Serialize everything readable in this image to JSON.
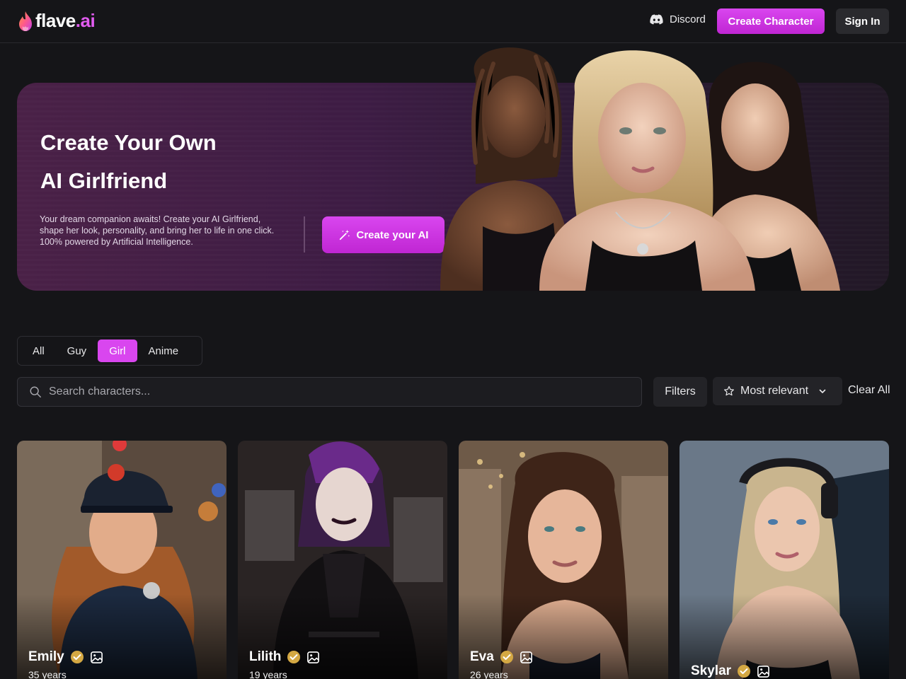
{
  "header": {
    "logo_text_main": "flave",
    "logo_text_suffix": ".ai",
    "discord_label": "Discord",
    "create_character_label": "Create Character",
    "sign_in_label": "Sign In"
  },
  "hero": {
    "title_line1": "Create Your Own",
    "title_line2": "AI Girlfriend",
    "description": "Your dream companion awaits! Create your AI Girlfriend, shape her look, personality, and bring her to life in one click. 100% powered by Artificial Intelligence.",
    "cta_label": "Create your AI"
  },
  "categories": {
    "tabs": [
      {
        "label": "All",
        "active": false
      },
      {
        "label": "Guy",
        "active": false
      },
      {
        "label": "Girl",
        "active": true
      },
      {
        "label": "Anime",
        "active": false
      }
    ]
  },
  "search": {
    "placeholder": "Search characters..."
  },
  "toolbar": {
    "filters_label": "Filters",
    "sort_label": "Most relevant",
    "clear_label": "Clear All"
  },
  "characters": [
    {
      "name": "Emily",
      "age": "35 years"
    },
    {
      "name": "Lilith",
      "age": "19 years"
    },
    {
      "name": "Eva",
      "age": "26 years"
    },
    {
      "name": "Skylar",
      "age": ""
    }
  ],
  "colors": {
    "accent": "#d946ef",
    "background": "#151518",
    "verified_badge": "#d4a843"
  },
  "icons": {
    "logo": "flame-icon",
    "discord": "discord-icon",
    "cta": "magic-wand-icon",
    "search": "search-icon",
    "sort": "star-icon",
    "sort_chevron": "chevron-down-icon",
    "verified": "verified-badge-icon",
    "gallery": "image-icon"
  }
}
